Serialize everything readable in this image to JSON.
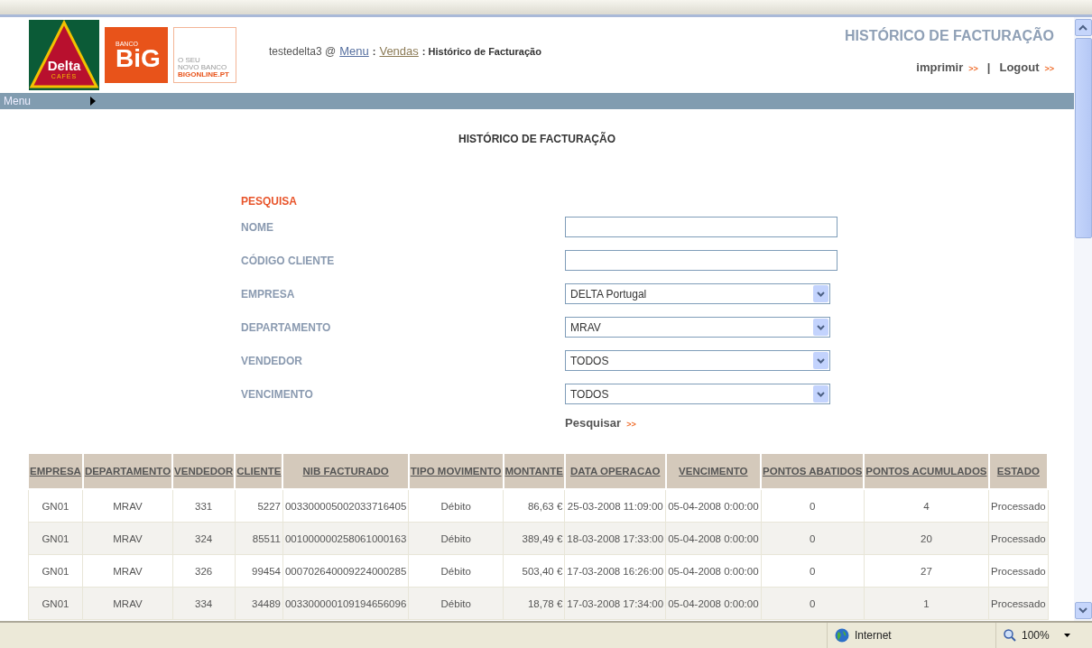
{
  "logos": {
    "delta": {
      "name": "Delta",
      "sub": "CAFÉS"
    },
    "big": {
      "top": "BANCO",
      "name": "BiG"
    },
    "promo": {
      "line1": "O SEU",
      "line2": "NOVO BANCO",
      "line3": "BIGONLINE.PT"
    }
  },
  "breadcrumb": {
    "user": "testedelta3 @",
    "items": [
      {
        "label": "Menu",
        "kind": "link"
      },
      {
        "label": ":",
        "kind": "sep"
      },
      {
        "label": "Vendas",
        "kind": "link"
      },
      {
        "label": ": Histórico de Facturação",
        "kind": "current"
      }
    ]
  },
  "header": {
    "title": "HISTÓRICO DE FACTURAÇÃO",
    "links": [
      {
        "label": "imprimir",
        "arrow": ">>"
      },
      {
        "label": "Logout",
        "arrow": ">>"
      }
    ],
    "divider": "|"
  },
  "menu_bar": {
    "label": "Menu"
  },
  "page_title": "HISTÓRICO DE FACTURAÇÃO",
  "search": {
    "title": "PESQUISA",
    "fields": [
      {
        "label": "NOME",
        "kind": "text"
      },
      {
        "label": "CÓDIGO CLIENTE",
        "kind": "text"
      },
      {
        "label": "EMPRESA",
        "kind": "select",
        "value": "DELTA Portugal"
      },
      {
        "label": "DEPARTAMENTO",
        "kind": "select",
        "value": "MRAV"
      },
      {
        "label": "VENDEDOR",
        "kind": "select",
        "value": "TODOS"
      },
      {
        "label": "VENCIMENTO",
        "kind": "select",
        "value": "TODOS"
      }
    ],
    "button": {
      "label": "Pesquisar",
      "arrow": ">>"
    }
  },
  "table": {
    "columns": [
      "EMPRESA",
      "DEPARTAMENTO",
      "VENDEDOR",
      "CLIENTE",
      "NIB FACTURADO",
      "TIPO MOVIMENTO",
      "MONTANTE",
      "DATA OPERACAO",
      "VENCIMENTO",
      "PONTOS ABATIDOS",
      "PONTOS ACUMULADOS",
      "ESTADO"
    ],
    "rows": [
      [
        "GN01",
        "MRAV",
        "331",
        "5227",
        "003300005002033716405",
        "Débito",
        "86,63 €",
        "25-03-2008 11:09:00",
        "05-04-2008 0:00:00",
        "0",
        "4",
        "Processado"
      ],
      [
        "GN01",
        "MRAV",
        "324",
        "85511",
        "001000000258061000163",
        "Débito",
        "389,49 €",
        "18-03-2008 17:33:00",
        "05-04-2008 0:00:00",
        "0",
        "20",
        "Processado"
      ],
      [
        "GN01",
        "MRAV",
        "326",
        "99454",
        "000702640009224000285",
        "Débito",
        "503,40 €",
        "17-03-2008 16:26:00",
        "05-04-2008 0:00:00",
        "0",
        "27",
        "Processado"
      ],
      [
        "GN01",
        "MRAV",
        "334",
        "34489",
        "003300000109194656096",
        "Débito",
        "18,78 €",
        "17-03-2008 17:34:00",
        "05-04-2008 0:00:00",
        "0",
        "1",
        "Processado"
      ]
    ]
  },
  "status_bar": {
    "zone": "Internet",
    "zoom": "100%"
  }
}
